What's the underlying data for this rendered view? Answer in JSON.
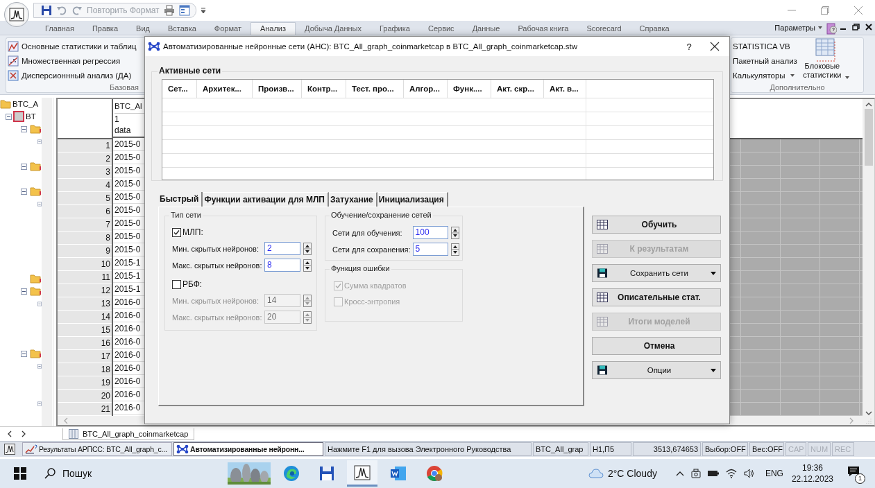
{
  "title_bar": {
    "quick_access_label": "Повторить Формат"
  },
  "menu_tabs": [
    {
      "label": "Главная",
      "selected": false
    },
    {
      "label": "Правка",
      "selected": false
    },
    {
      "label": "Вид",
      "selected": false
    },
    {
      "label": "Вставка",
      "selected": false
    },
    {
      "label": "Формат",
      "selected": false
    },
    {
      "label": "Анализ",
      "selected": true
    },
    {
      "label": "Добыча Данных",
      "selected": false
    },
    {
      "label": "Графика",
      "selected": false
    },
    {
      "label": "Сервис",
      "selected": false
    },
    {
      "label": "Данные",
      "selected": false
    },
    {
      "label": "Рабочая книга",
      "selected": false
    },
    {
      "label": "Scorecard",
      "selected": false
    },
    {
      "label": "Справка",
      "selected": false
    }
  ],
  "menu_right": {
    "label": "Параметры"
  },
  "ribbon": {
    "left_items": [
      "Основные статистики и таблиц",
      "Множественная регрессия",
      "Дисперсионнный анализ (ДА)"
    ],
    "left_caption": "Базовая",
    "right_items": [
      {
        "label": "STATISTICA VB",
        "dropdown": false
      },
      {
        "label": "Пакетный анализ",
        "dropdown": false
      },
      {
        "label": "Калькуляторы",
        "dropdown": true
      }
    ],
    "big_button": "Блоковые статистики",
    "right_caption": "Дополнительно"
  },
  "tree": {
    "items": [
      {
        "label": "BTC_A",
        "children": [
          {
            "label": "BT"
          }
        ]
      }
    ]
  },
  "sheet": {
    "column_1": {
      "name": "BTC_Al",
      "number": "1",
      "subtitle": "data"
    },
    "rows": [
      {
        "number": "1",
        "value": "2015-0"
      },
      {
        "number": "2",
        "value": "2015-0"
      },
      {
        "number": "3",
        "value": "2015-0"
      },
      {
        "number": "4",
        "value": "2015-0"
      },
      {
        "number": "5",
        "value": "2015-0"
      },
      {
        "number": "6",
        "value": "2015-0"
      },
      {
        "number": "7",
        "value": "2015-0"
      },
      {
        "number": "8",
        "value": "2015-0"
      },
      {
        "number": "9",
        "value": "2015-0"
      },
      {
        "number": "10",
        "value": "2015-1"
      },
      {
        "number": "11",
        "value": "2015-1"
      },
      {
        "number": "12",
        "value": "2015-1"
      },
      {
        "number": "13",
        "value": "2016-0"
      },
      {
        "number": "14",
        "value": "2016-0"
      },
      {
        "number": "15",
        "value": "2016-0"
      },
      {
        "number": "16",
        "value": "2016-0"
      },
      {
        "number": "17",
        "value": "2016-0"
      },
      {
        "number": "18",
        "value": "2016-0"
      },
      {
        "number": "19",
        "value": "2016-0"
      },
      {
        "number": "20",
        "value": "2016-0"
      },
      {
        "number": "21",
        "value": "2016-0"
      }
    ]
  },
  "sheet_tab": "BTC_All_graph_coinmarketcap",
  "dialog": {
    "title": "Автоматизированные нейронные сети (АНС): BTC_All_graph_coinmarketcap в BTC_All_graph_coinmarketcap.stw",
    "help": "?",
    "active_nets": {
      "title": "Активные сети",
      "columns": [
        "Сет...",
        "Архитек...",
        "Произв...",
        "Контр...",
        "Тест. про...",
        "Алгор...",
        "Функ....",
        "Акт. скр...",
        "Акт. в..."
      ]
    },
    "tabs": [
      {
        "label": "Быстрый",
        "selected": true
      },
      {
        "label": "Функции активации для МЛП",
        "selected": false
      },
      {
        "label": "Затухание",
        "selected": false
      },
      {
        "label": "Инициализация",
        "selected": false
      }
    ],
    "network_type": {
      "title": "Тип сети",
      "options": [
        {
          "label": "МЛП:",
          "checked": true,
          "fields": [
            {
              "label": "Мин. скрытых нейронов:",
              "value": "2",
              "disabled": false
            },
            {
              "label": "Макс. скрытых нейронов:",
              "value": "8",
              "disabled": false
            }
          ]
        },
        {
          "label": "РБФ:",
          "checked": false,
          "fields": [
            {
              "label": "Мин. скрытых нейронов:",
              "value": "14",
              "disabled": true
            },
            {
              "label": "Макс. скрытых нейронов:",
              "value": "20",
              "disabled": true
            }
          ]
        }
      ]
    },
    "training": {
      "title": "Обучение/сохранение сетей",
      "fields": [
        {
          "label": "Сети для обучения:",
          "value": "100"
        },
        {
          "label": "Сети для сохранения:",
          "value": "5"
        }
      ]
    },
    "error_function": {
      "title": "Функция ошибки",
      "options": [
        {
          "label": "Сумма квадратов",
          "checked": true,
          "disabled": true
        },
        {
          "label": "Кросс-энтропия",
          "checked": false,
          "disabled": true
        }
      ]
    },
    "buttons": [
      {
        "label": "Обучить",
        "kind": "action",
        "disabled": false
      },
      {
        "label": "К результатам",
        "kind": "action",
        "disabled": true
      },
      {
        "label": "Сохранить сети",
        "kind": "menu",
        "disabled": false
      },
      {
        "label": "Описательные стат.",
        "kind": "action",
        "disabled": false
      },
      {
        "label": "Итоги моделей",
        "kind": "action",
        "disabled": true
      },
      {
        "label": "Отмена",
        "kind": "plain",
        "disabled": false
      },
      {
        "label": "Опции",
        "kind": "menu",
        "disabled": false
      }
    ]
  },
  "status_bar": {
    "tasks": [
      {
        "label": "Результаты АРПСС: BTC_All_graph_c...",
        "selected": false
      },
      {
        "label": "Автоматизированные нейронн...",
        "selected": true
      }
    ],
    "hint": "Нажмите F1 для вызова Электронного Руководства",
    "fields": [
      {
        "text": "BTC_All_grap",
        "disabled": false
      },
      {
        "text": "H1,П5",
        "disabled": false
      },
      {
        "text": "3513,674653",
        "disabled": false
      },
      {
        "text": "Выбор:OFF",
        "disabled": false
      },
      {
        "text": "Вес:OFF",
        "disabled": false
      },
      {
        "text": "CAP",
        "disabled": true
      },
      {
        "text": "NUM",
        "disabled": true
      },
      {
        "text": "REC",
        "disabled": true
      }
    ]
  },
  "taskbar": {
    "search": "Пошук",
    "weather": "2°C Cloudy",
    "language": "ENG",
    "time": "19:36",
    "date": "22.12.2023",
    "notifications": "1"
  }
}
